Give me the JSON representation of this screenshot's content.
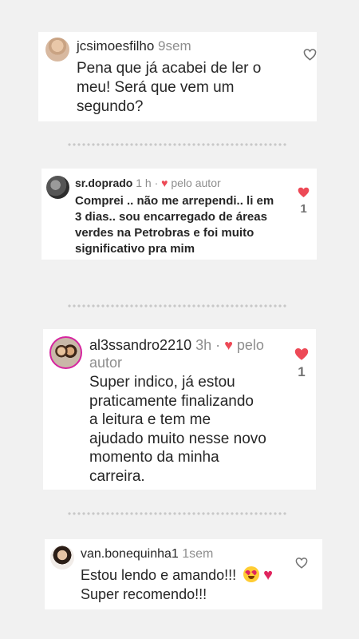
{
  "comments": [
    {
      "username": "jcsimoesfilho",
      "time": "9sem",
      "text_lines": [
        "Pena que já acabei de ler o",
        "meu! Será que vem um",
        "segundo?"
      ],
      "liked": false,
      "like_count": ""
    },
    {
      "username": "sr.doprado",
      "time": "1 h",
      "author_tag": "pelo autor",
      "text_lines": [
        "Comprei .. não me arrependi.. li em",
        "3 dias.. sou encarregado de áreas",
        "verdes na Petrobras e foi muito",
        "significativo pra mim"
      ],
      "liked": true,
      "like_count": "1"
    },
    {
      "username": "al3ssandro2210",
      "time": "3h",
      "author_tag_line1": "pelo",
      "author_tag_line2": "autor",
      "text_lines": [
        "Super indico, já estou",
        "praticamente finalizando",
        "a leitura e tem me",
        "ajudado muito nesse novo",
        "momento da minha",
        "carreira."
      ],
      "liked": true,
      "like_count": "1"
    },
    {
      "username": "van.bonequinha1",
      "time": "1sem",
      "text_line1": "Estou lendo e amando!!!",
      "text_line2": "Super recomendo!!!",
      "liked": false,
      "like_count": ""
    }
  ],
  "icons": {
    "like_empty": "heart-outline-icon",
    "like_filled": "heart-filled-icon",
    "emoji_1": "heart-eyes-emoji",
    "emoji_2": "red-heart-emoji"
  },
  "colors": {
    "background": "#f1f1f1",
    "card": "#ffffff",
    "like_red": "#ed4956",
    "text": "#262626",
    "meta": "#8e8e8e"
  }
}
